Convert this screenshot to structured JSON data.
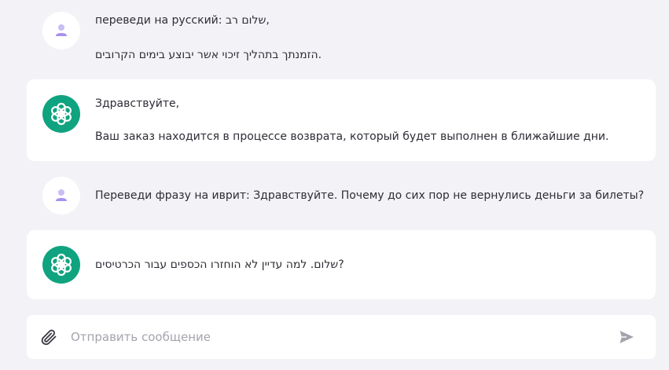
{
  "conversation": [
    {
      "role": "user",
      "lines": [
        "переведи на русский: שלום רב,",
        "הזמנתך בתהליך זיכוי אשר יבוצע בימים הקרובים."
      ]
    },
    {
      "role": "assistant",
      "lines": [
        "Здравствуйте,",
        "Ваш заказ находится в процессе возврата, который будет выполнен в ближайшие дни."
      ]
    },
    {
      "role": "user",
      "lines": [
        "Переведи фразу на иврит: Здравствуйте. Почему до сих пор не вернулись деньги за билеты?"
      ]
    },
    {
      "role": "assistant",
      "lines": [
        "שלום. למה עדיין לא הוחזרו הכספים עבור הכרטיסים?"
      ]
    }
  ],
  "composer": {
    "placeholder": "Отправить сообщение",
    "attach_icon": "paperclip-icon",
    "send_icon": "send-icon"
  },
  "colors": {
    "background": "#f3f3f7",
    "assistant_avatar": "#10a37f",
    "user_avatar_figure": "#b8a6ef",
    "icon_gray": "#a4a4ad"
  }
}
